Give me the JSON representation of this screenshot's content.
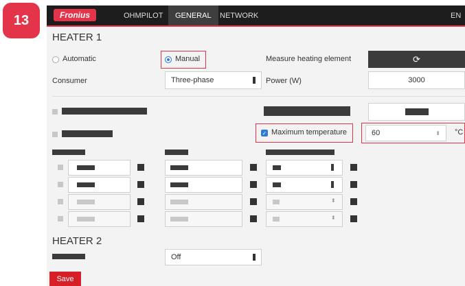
{
  "step_badge": "13",
  "brand": {
    "logo_text": "Fronius"
  },
  "nav": {
    "items": [
      "OHMPILOT",
      "GENERAL",
      "NETWORK"
    ],
    "active": "GENERAL",
    "language": "EN"
  },
  "heater1": {
    "title": "HEATER 1",
    "mode_automatic": "Automatic",
    "mode_manual": "Manual",
    "mode_selected": "Manual",
    "measure_label": "Measure heating element",
    "refresh_icon": "⟳",
    "consumer_label": "Consumer",
    "consumer_value": "Three-phase",
    "power_label": "Power (W)",
    "power_value": "3000",
    "max_temp_label": "Maximum temperature",
    "max_temp_checked": true,
    "max_temp_value": "60",
    "max_temp_unit": "°C"
  },
  "heater2": {
    "title": "HEATER 2",
    "select_value": "Off"
  },
  "actions": {
    "save_label": "Save"
  },
  "colors": {
    "accent": "#e3344a",
    "topbar": "#1d1d1d",
    "checkbox": "#2d7bd4",
    "save": "#d61f26"
  }
}
